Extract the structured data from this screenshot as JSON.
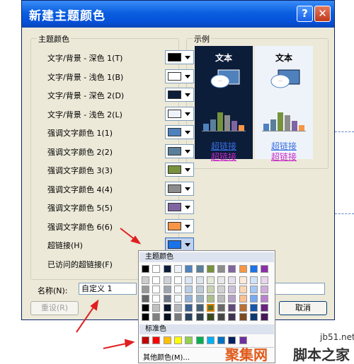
{
  "dialog": {
    "title": "新建主题颜色",
    "help_glyph": "?",
    "close_glyph": "✕"
  },
  "theme_group": {
    "title": "主题颜色",
    "rows": [
      {
        "label": "文字/背景 - 深色 1(T)",
        "color": "#000000"
      },
      {
        "label": "文字/背景 - 浅色 1(B)",
        "color": "#ffffff"
      },
      {
        "label": "文字/背景 - 深色 2(D)",
        "color": "#0c1d3a"
      },
      {
        "label": "文字/背景 - 浅色 2(L)",
        "color": "#eef3fa"
      },
      {
        "label": "强调文字颜色 1(1)",
        "color": "#4f81bd"
      },
      {
        "label": "强调文字颜色 2(2)",
        "color": "#5a7f9a"
      },
      {
        "label": "强调文字颜色 3(3)",
        "color": "#76923c"
      },
      {
        "label": "强调文字颜色 4(4)",
        "color": "#8c8c8c"
      },
      {
        "label": "强调文字颜色 5(5)",
        "color": "#8064a2"
      },
      {
        "label": "强调文字颜色 6(6)",
        "color": "#f79646"
      },
      {
        "label": "超链接(H)",
        "color": "#1a73e8"
      },
      {
        "label": "已访问的超链接(F)",
        "color": "#8b2fa8"
      }
    ]
  },
  "sample": {
    "title": "示例",
    "text": "文本",
    "link": "超链接",
    "visited_link": "超链接",
    "link_color": "#3a6fe3",
    "visited_color": "#c82ac8",
    "dark_bg": "#0c1d3a",
    "light_bg": "#eef3fa",
    "bar_colors": [
      "#4f81bd",
      "#5a7f9a",
      "#76923c",
      "#8c8c8c",
      "#8064a2",
      "#f79646"
    ]
  },
  "name_field": {
    "label": "名称(N):",
    "value": "自定义 1"
  },
  "buttons": {
    "reset": "重设(R)",
    "cancel": "取消"
  },
  "popup": {
    "theme_header": "主题颜色",
    "standard_header": "标准色",
    "more_label": "其他颜色(M)...",
    "theme_row": [
      "#000000",
      "#ffffff",
      "#0c1d3a",
      "#eef3fa",
      "#4f81bd",
      "#5a7f9a",
      "#76923c",
      "#8c8c8c",
      "#8064a2",
      "#f79646",
      "#1a73e8",
      "#8b2fa8"
    ],
    "standard_row": [
      "#c00000",
      "#ff0000",
      "#ffc000",
      "#ffff00",
      "#92d050",
      "#00b050",
      "#00b0f0",
      "#0070c0",
      "#002060",
      "#7030a0"
    ]
  },
  "watermarks": {
    "site": "jb51.net",
    "cn_left": "聚集网",
    "cn_right": "脚本之家"
  }
}
